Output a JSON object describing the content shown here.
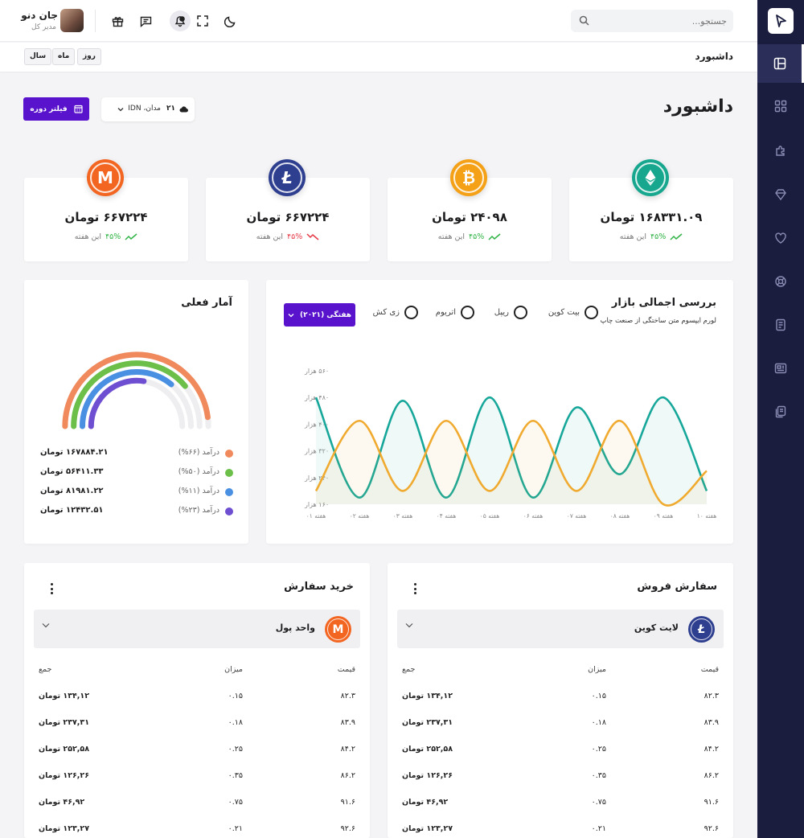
{
  "header": {
    "search_placeholder": "جستجو...",
    "user_name": "جان دنو",
    "user_role": "مدیر کل"
  },
  "subbar": {
    "breadcrumb": "داشبورد",
    "periods": [
      "روز",
      "ماه",
      "سال"
    ]
  },
  "page": {
    "title": "داشبورد",
    "select_number": "۲۱",
    "select_label": "مدان، IDN",
    "filter_label": "فیلتر دوره"
  },
  "stats": [
    {
      "amount": "۱۶۸۳۳۱.۰۹ تومان",
      "pct": "۴۵%",
      "period": "این هفته",
      "trend": "up",
      "coin": "ethereum-icon",
      "color": "#17a78e"
    },
    {
      "amount": "۲۴۰۹۸ تومان",
      "pct": "۴۵%",
      "period": "این هفته",
      "trend": "up",
      "coin": "bitcoin-icon",
      "color": "#f4a118"
    },
    {
      "amount": "۶۶۷۲۲۴ تومان",
      "pct": "۴۵%",
      "period": "این هفته",
      "trend": "down",
      "coin": "litecoin-icon",
      "color": "#2f3f8f"
    },
    {
      "amount": "۶۶۷۲۲۴ تومان",
      "pct": "۴۵%",
      "period": "این هفته",
      "trend": "up",
      "coin": "monero-icon",
      "color": "#f26622"
    }
  ],
  "market": {
    "title": "بررسی اجمالی بازار",
    "subtitle": "لورم ایپسوم متن ساختگی از صنعت چاپ",
    "options": [
      "بیت کوین",
      "ریپل",
      "اتریوم",
      "زی کش"
    ],
    "dropdown": "هفتگی (۲۰۲۱)"
  },
  "chart_data": {
    "type": "area",
    "x": [
      "هفته ۰۱",
      "هفته ۰۲",
      "هفته ۰۳",
      "هفته ۰۴",
      "هفته ۰۵",
      "هفته ۰۶",
      "هفته ۰۷",
      "هفته ۰۸",
      "هفته ۰۹",
      "هفته ۱۰"
    ],
    "y_ticks": [
      "۱۶۰ هزار",
      "۲۴۰ هزار",
      "۳۲۰ هزار",
      "۴۰۰ هزار",
      "۴۸۰ هزار",
      "۵۶۰ هزار"
    ],
    "ylim": [
      160,
      560
    ],
    "series": [
      {
        "color": "#17a79a",
        "values": [
          480,
          180,
          470,
          180,
          480,
          180,
          450,
          250,
          480,
          200
        ]
      },
      {
        "color": "#f0aa2f",
        "values": [
          200,
          410,
          200,
          410,
          200,
          410,
          200,
          410,
          160,
          260
        ]
      }
    ],
    "grid": false
  },
  "current_stats": {
    "title": "آمار فعلی",
    "gauge_fractions": [
      0.66,
      0.5,
      0.11,
      0.23
    ],
    "items": [
      {
        "label": "درآمد (۶۶%)",
        "value": "۱۶۷۸۸۴.۲۱ تومان",
        "color": "#f08a5d"
      },
      {
        "label": "درآمد (۵۰%)",
        "value": "۵۶۴۱۱.۳۳ تومان",
        "color": "#6cc04a"
      },
      {
        "label": "درآمد (۱۱%)",
        "value": "۸۱۹۸۱.۲۲ تومان",
        "color": "#4a90e2"
      },
      {
        "label": "درآمد (۲۳%)",
        "value": "۱۲۴۳۲.۵۱ تومان",
        "color": "#6f4fd1"
      }
    ]
  },
  "orders": {
    "headers": {
      "price": "قیمت",
      "amount": "میزان",
      "total": "جمع"
    },
    "sell": {
      "title": "سفارش فروش",
      "coin_name": "لایت کوین",
      "rows": [
        [
          "۸۲.۳",
          "۰.۱۵",
          "۱۳۴,۱۲ تومان"
        ],
        [
          "۸۳.۹",
          "۰.۱۸",
          "۲۳۷,۳۱ تومان"
        ],
        [
          "۸۴.۲",
          "۰.۲۵",
          "۲۵۲,۵۸ تومان"
        ],
        [
          "۸۶.۲",
          "۰.۳۵",
          "۱۲۶,۲۶ تومان"
        ],
        [
          "۹۱.۶",
          "۰.۷۵",
          "۴۶,۹۲ تومان"
        ],
        [
          "۹۲.۶",
          "۰.۲۱",
          "۱۲۳,۲۷ تومان"
        ]
      ]
    },
    "buy": {
      "title": "خرید سفارش",
      "coin_name": "واحد پول",
      "rows": [
        [
          "۸۲.۳",
          "۰.۱۵",
          "۱۳۴,۱۲ تومان"
        ],
        [
          "۸۳.۹",
          "۰.۱۸",
          "۲۳۷,۳۱ تومان"
        ],
        [
          "۸۴.۲",
          "۰.۲۵",
          "۲۵۲,۵۸ تومان"
        ],
        [
          "۸۶.۲",
          "۰.۳۵",
          "۱۲۶,۲۶ تومان"
        ],
        [
          "۹۱.۶",
          "۰.۷۵",
          "۴۶,۹۲ تومان"
        ],
        [
          "۹۲.۶",
          "۰.۲۱",
          "۱۲۳,۲۷ تومان"
        ]
      ]
    }
  }
}
